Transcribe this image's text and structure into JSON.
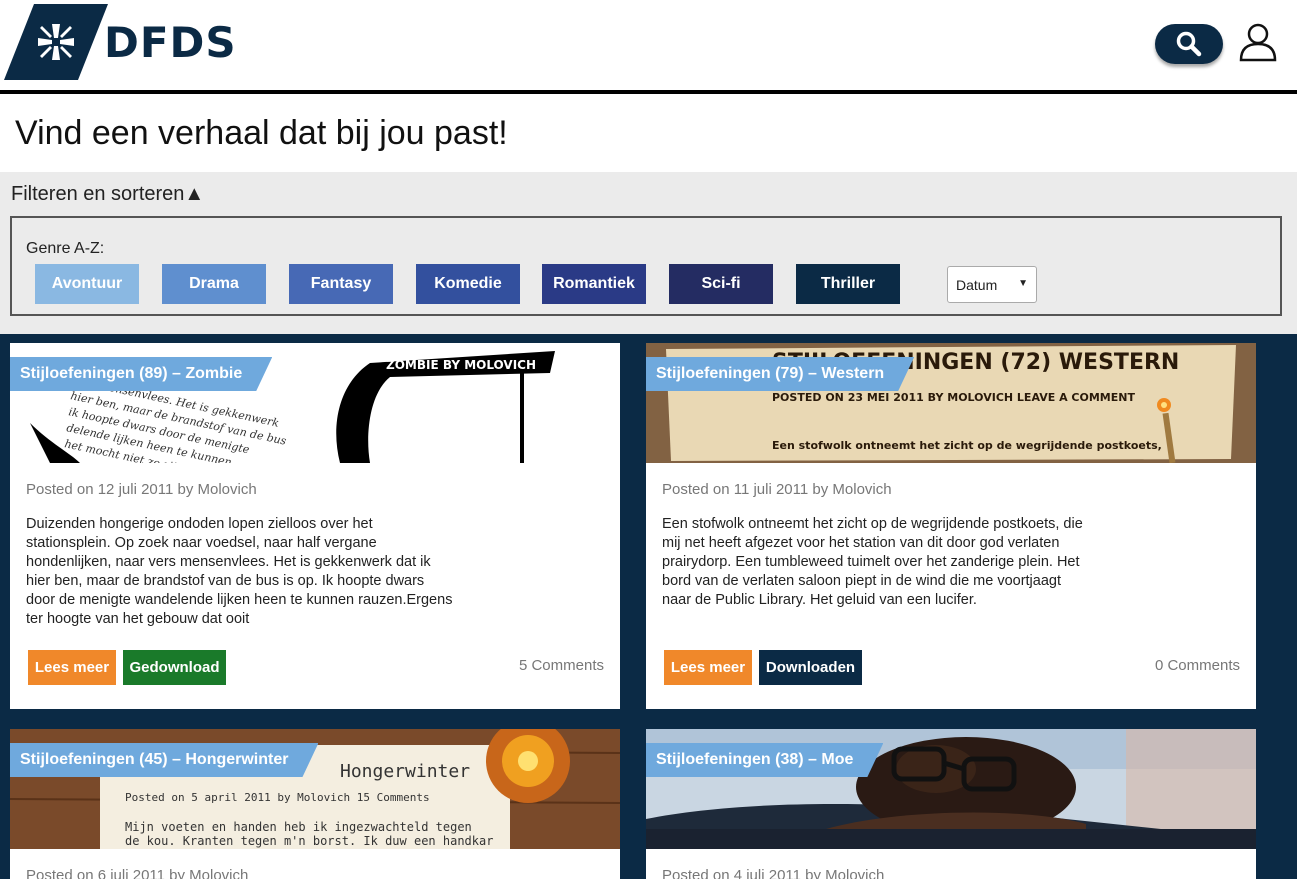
{
  "brand": {
    "name": "DFDS"
  },
  "header": {
    "search_icon": "search-icon",
    "account_icon": "user-icon"
  },
  "page": {
    "title": "Vind een verhaal dat bij jou past!"
  },
  "filter": {
    "toggle_label": "Filteren en sorteren",
    "toggle_arrow": "▲",
    "genre_label": "Genre A-Z:",
    "genres": [
      {
        "label": "Avontuur",
        "color": "#8ab8e2"
      },
      {
        "label": "Drama",
        "color": "#5f8fcf"
      },
      {
        "label": "Fantasy",
        "color": "#4769b5"
      },
      {
        "label": "Komedie",
        "color": "#33509e"
      },
      {
        "label": "Romantiek",
        "color": "#2a3a86"
      },
      {
        "label": "Sci-fi",
        "color": "#242c62"
      },
      {
        "label": "Thriller",
        "color": "#0b2a45"
      }
    ],
    "sort": {
      "selected": "Datum"
    }
  },
  "posts": [
    {
      "title": "Stijloefeningen (89) – Zombie",
      "meta": "Posted on 12 juli 2011 by Molovich",
      "excerpt": "Duizenden hongerige ondoden lopen zielloos over het stationsplein. Op zoek naar voedsel, naar half vergane hondenlijken, naar vers mensenvlees. Het is gekkenwerk dat ik hier ben, maar de brandstof van de bus is op. Ik hoopte dwars door de menigte wandelende lijken heen te kunnen rauzen.Ergens ter hoogte van het gebouw dat ooit",
      "read_label": "Lees meer",
      "download_label": "Gedownload",
      "downloaded": true,
      "comments": "5 Comments",
      "image_text": "ZOMBIE BY MOLOVICH"
    },
    {
      "title": "Stijloefeningen (79) – Western",
      "meta": "Posted on 11 juli 2011 by Molovich",
      "excerpt": "Een stofwolk ontneemt het zicht op de wegrijdende postkoets, die mij net heeft afgezet voor het station van dit door god verlaten prairydorp. Een tumbleweed tuimelt over het zanderige plein. Het bord van de verlaten saloon piept in de wind die me voortjaagt naar de Public Library. Het geluid van een lucifer.",
      "read_label": "Lees meer",
      "download_label": "Downloaden",
      "downloaded": false,
      "comments": "0 Comments",
      "image_text": "STIJLOEFENINGEN (72) WESTERN"
    },
    {
      "title": "Stijloefeningen (45) – Hongerwinter",
      "meta": "Posted on 6 juli 2011 by Molovich",
      "image_text": "Hongerwinter"
    },
    {
      "title": "Stijloefeningen (38) – Moe",
      "meta": "Posted on 4 juli 2011 by Molovich"
    }
  ]
}
